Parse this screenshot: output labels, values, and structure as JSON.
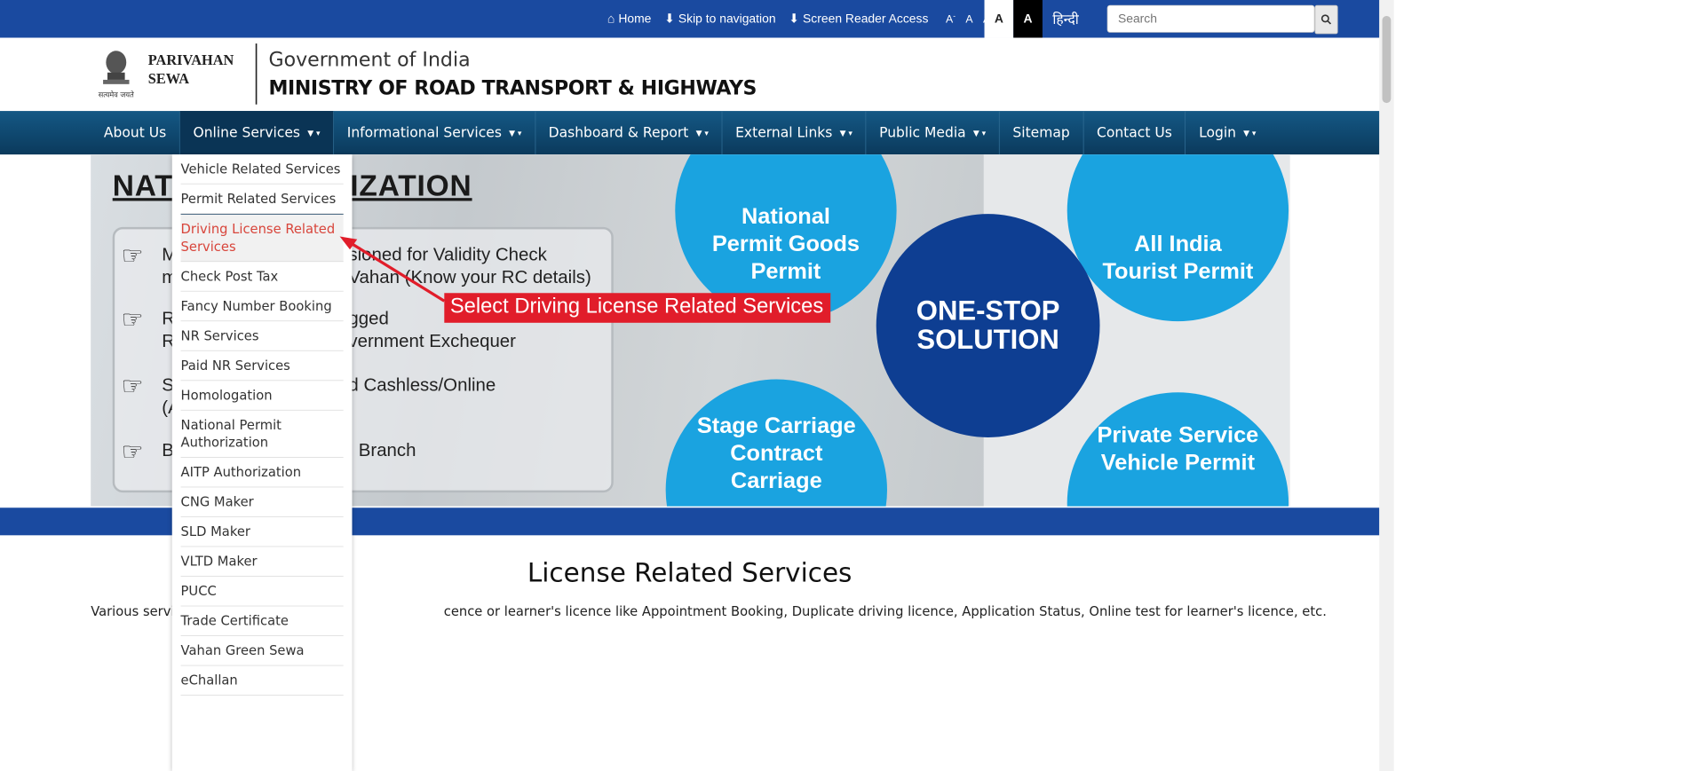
{
  "topbar": {
    "home": "Home",
    "skip": "Skip to navigation",
    "screen_reader": "Screen Reader Access",
    "font_small": "A",
    "font_small_sup": "-",
    "font_normal": "A",
    "font_large": "A",
    "font_large_sup": "+",
    "contrast_light": "A",
    "contrast_dark": "A",
    "language": "हिन्दी",
    "search_placeholder": "Search"
  },
  "header": {
    "org_line1": "PARIVAHAN",
    "org_line2": "SEWA",
    "emblem_motto": "सत्यमेव जयते",
    "gov": "Government of India",
    "ministry": "MINISTRY OF ROAD TRANSPORT & HIGHWAYS"
  },
  "nav": {
    "items": [
      "About Us",
      "Online Services",
      "Informational Services",
      "Dashboard & Report",
      "External Links",
      "Public Media",
      "Sitemap",
      "Contact Us",
      "Login"
    ]
  },
  "dropdown": {
    "items": [
      "Vehicle Related Services",
      "Permit Related Services",
      "Driving License Related Services",
      "Check Post Tax",
      "Fancy Number Booking",
      "NR Services",
      "Paid NR Services",
      "Homologation",
      "National Permit Authorization",
      "AITP Authorization",
      "CNG Maker",
      "SLD Maker",
      "VLTD Maker",
      "PUCC",
      "Trade Certificate",
      "Vahan Green Sewa",
      "eChallan"
    ]
  },
  "banner": {
    "title": "NAT          IT AUTHORIZATION",
    "line1a": "M",
    "line1b": "sioned for Validity Check",
    "line2a": "m",
    "line2b": "Vahan (Know your RC details)",
    "line3a": "R",
    "line3b": "gged",
    "line4a": "R",
    "line4b": "vernment Exchequer",
    "line5a": "S",
    "line5b": "d Cashless/Online",
    "line6a": "(A",
    "line7a": "B",
    "line7b": "I Branch",
    "circle1": "National Permit Goods Permit",
    "circle2": "All India Tourist Permit",
    "circle3": "ONE-STOP SOLUTION",
    "circle4": "Stage Carriage Contract Carriage",
    "circle5": "Private Service Vehicle Permit"
  },
  "annotation": "Select Driving License Related Services",
  "section": {
    "title": "License Related Services",
    "intro_a": "Various servic",
    "intro_b": "cence or learner's licence like Appointment Booking, Duplicate driving licence, Application Status, Online test for learner's licence, etc."
  },
  "colors": {
    "topbar": "#1a4aa0",
    "nav": "#0b3a5c",
    "highlight": "#d8453b",
    "callout": "#e11d2a",
    "circle_light": "#1aa3e0",
    "circle_dark": "#0e3e92"
  }
}
